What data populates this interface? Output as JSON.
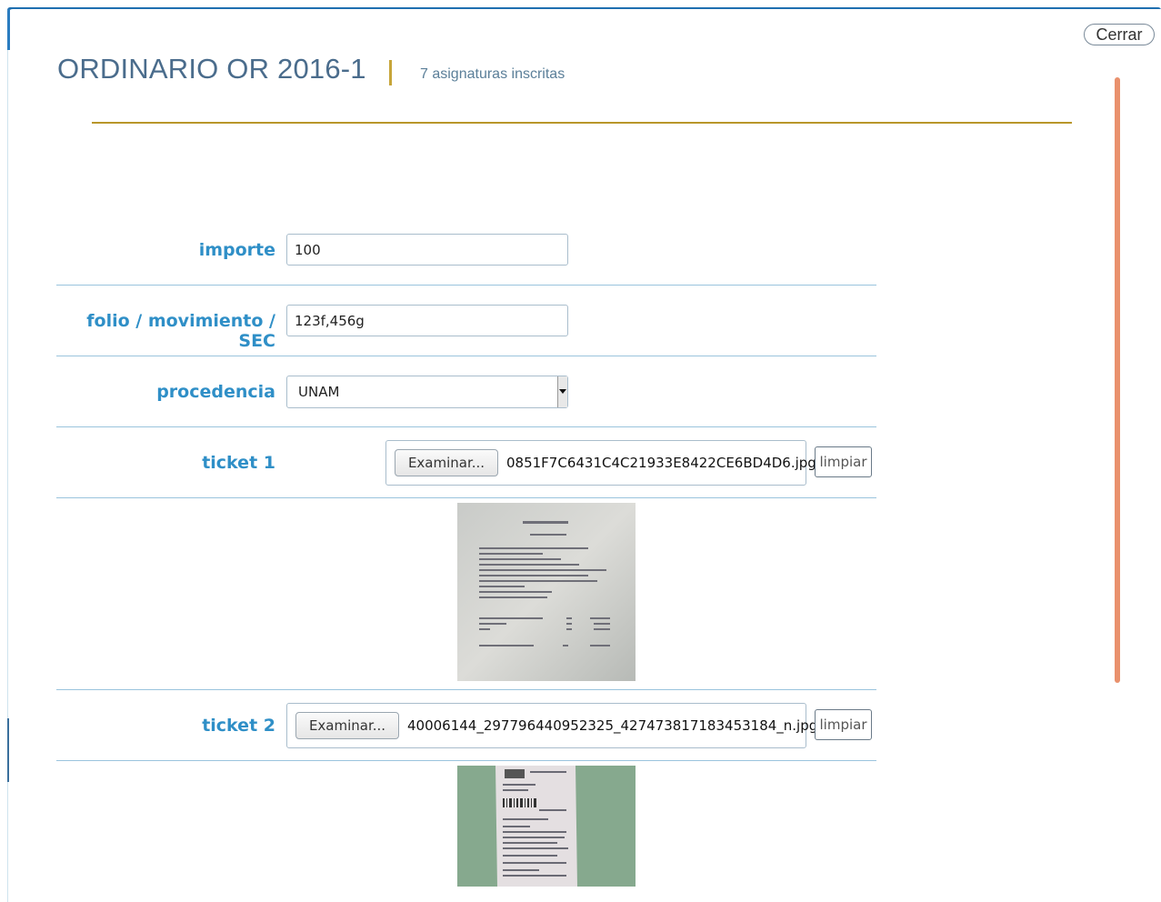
{
  "dialog": {
    "title": "ORDINARIO OR 2016-1",
    "subtitle": "7 asignaturas inscritas",
    "close_label": "Cerrar"
  },
  "form": {
    "importe": {
      "label": "importe",
      "value": "100"
    },
    "folio": {
      "label": "folio / movimiento / SEC",
      "value": "123f,456g"
    },
    "procedencia": {
      "label": "procedencia",
      "selected": "UNAM"
    },
    "ticket1": {
      "label": "ticket 1",
      "browse_label": "Examinar...",
      "file_name": "0851F7C6431C4C21933E8422CE6BD4D6.jpg",
      "clear_label": "limpiar"
    },
    "ticket2": {
      "label": "ticket 2",
      "browse_label": "Examinar...",
      "file_name": "40006144_297796440952325_427473817183453184_n.jpg",
      "clear_label": "limpiar"
    }
  },
  "colors": {
    "accent_blue": "#2f8fc7",
    "gold": "#b8962a",
    "scroll_indicator": "#e9916d",
    "title": "#4a6c8c"
  }
}
